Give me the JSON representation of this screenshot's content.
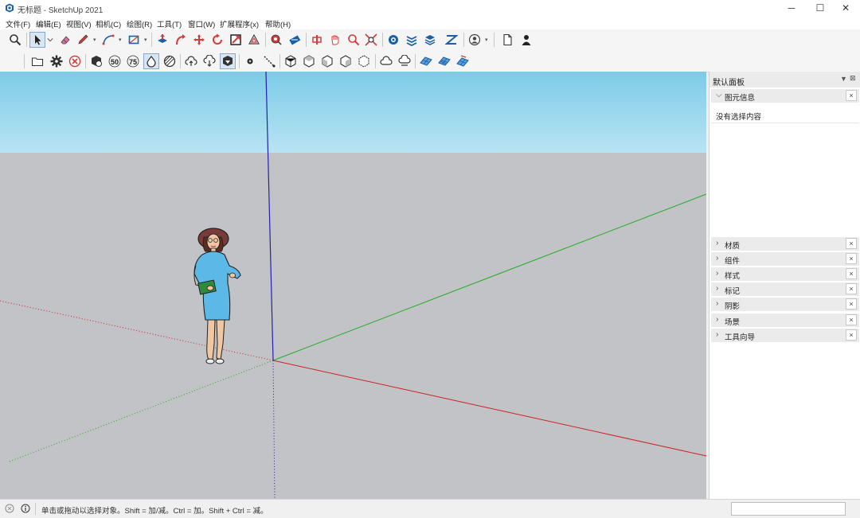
{
  "window": {
    "title": "无标题 - SketchUp 2021",
    "controls": {
      "minimize": "─",
      "maximize": "☐",
      "close": "✕"
    }
  },
  "menu": {
    "items": [
      "文件(F)",
      "编辑(E)",
      "视图(V)",
      "相机(C)",
      "绘图(R)",
      "工具(T)",
      "窗口(W)",
      "扩展程序(x)",
      "帮助(H)"
    ]
  },
  "toolbar1": {
    "icons": [
      "search-icon",
      "select-arrow-icon",
      "eraser-icon",
      "pencil-line-icon",
      "arc-icon",
      "rectangle-icon",
      "push-pull-icon",
      "offset-icon",
      "move-icon",
      "rotate-icon",
      "scale-icon",
      "follow-me-icon",
      "tape-measure-icon",
      "dimension-icon",
      "protractor-icon",
      "text-icon",
      "axes-icon",
      "section-plane-icon",
      "3d-warehouse-icon",
      "extension-warehouse-icon",
      "layout-icon",
      "profile-icon",
      "new-file-icon",
      "account-icon"
    ]
  },
  "toolbar2": {
    "icons": [
      "open-folder-icon",
      "settings-gear-icon",
      "cancel-circle-icon",
      "component-icon",
      "fifty-icon",
      "seventy-five-icon",
      "water-drop-icon",
      "hatch-circle-icon",
      "cloud-upload-icon",
      "cloud-download-icon",
      "send-icon",
      "dot-icon",
      "line-segment-icon",
      "iso-view-icon",
      "top-view-icon",
      "front-view-icon",
      "right-view-icon",
      "back-view-icon",
      "cloud-icon",
      "cloud-shade-icon",
      "sandbox-grid-icon",
      "sandbox-stamp-icon",
      "sandbox-drape-icon"
    ],
    "labels": {
      "fifty": "50",
      "seventy_five": "75"
    }
  },
  "panel": {
    "title": "默认面板",
    "entity_tray": {
      "label": "图元信息",
      "body_text": "没有选择内容",
      "close": "×"
    },
    "trays": [
      {
        "label": "材质",
        "close": "×"
      },
      {
        "label": "组件",
        "close": "×"
      },
      {
        "label": "样式",
        "close": "×"
      },
      {
        "label": "标记",
        "close": "×"
      },
      {
        "label": "阴影",
        "close": "×"
      },
      {
        "label": "场景",
        "close": "×"
      },
      {
        "label": "工具向导",
        "close": "×"
      }
    ]
  },
  "status": {
    "text": "单击或拖动以选择对象。Shift = 加/减。Ctrl = 加。Shift + Ctrl = 减。",
    "measurements_value": ""
  },
  "colors": {
    "sky_top": "#7dcbe8",
    "ground": "#c2c3c6",
    "axis_red": "#cc2222",
    "axis_green": "#22aa22",
    "axis_blue": "#2222aa",
    "figure_dress": "#5cb8e6",
    "figure_hat": "#7a3a3a"
  }
}
